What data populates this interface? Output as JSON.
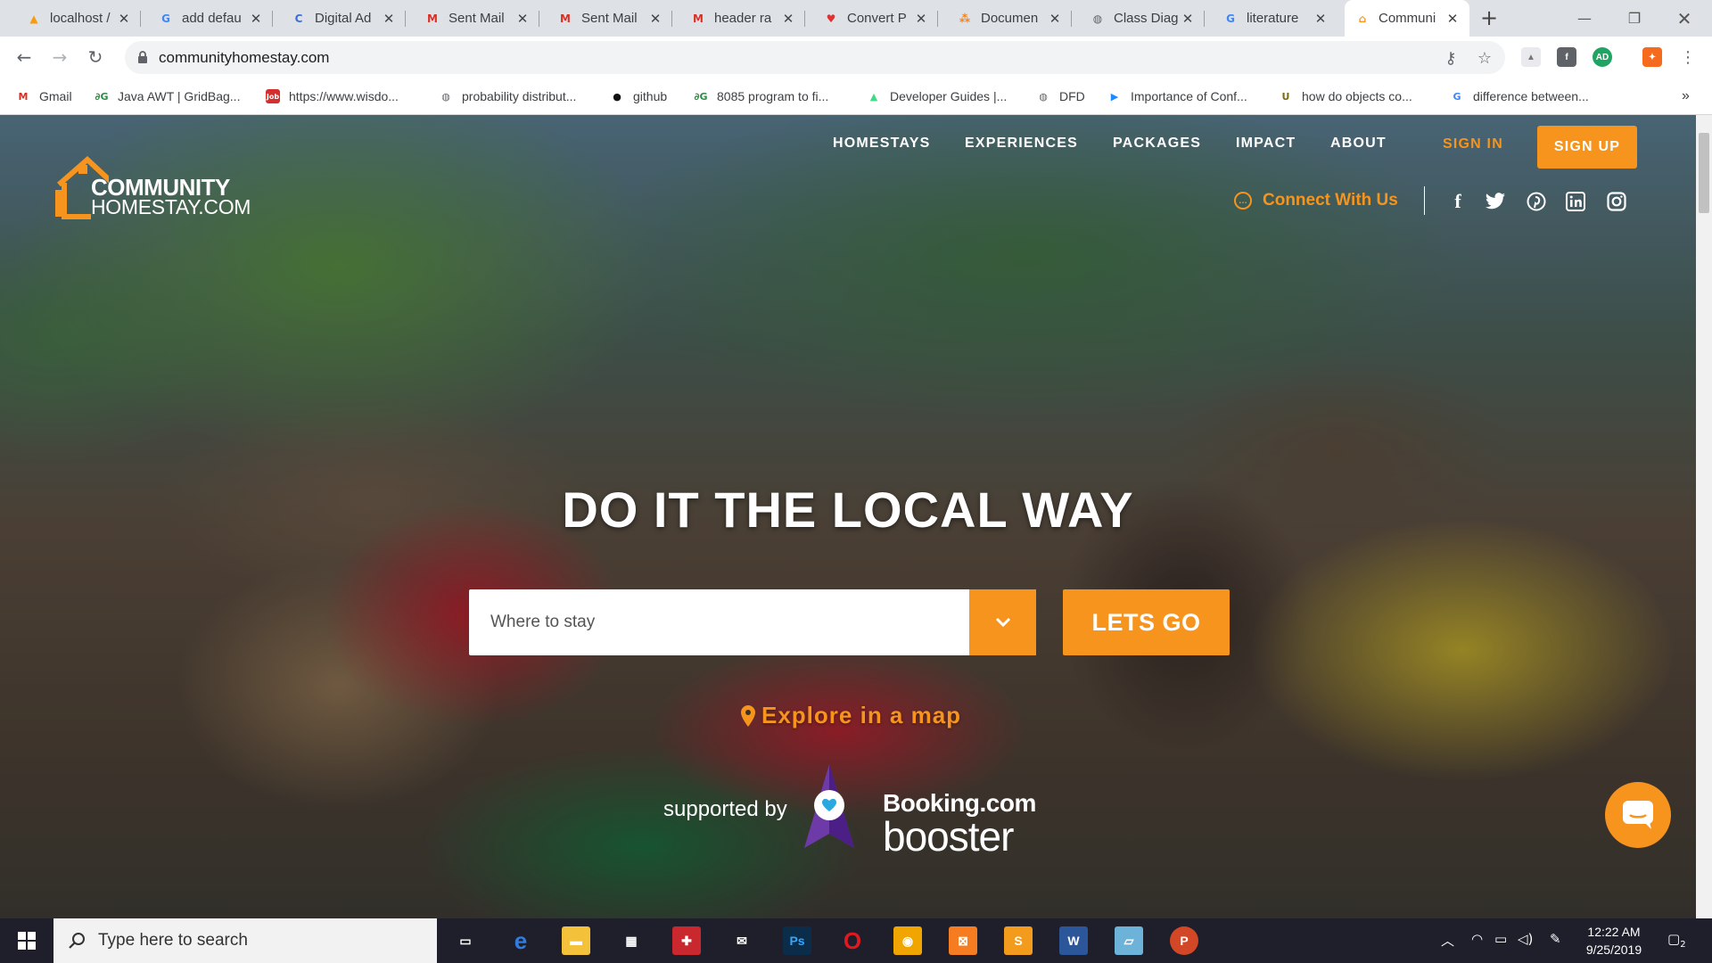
{
  "browser": {
    "tabs": [
      {
        "label": "localhost /",
        "favicon": "phpmyadmin-icon",
        "color": "#f89c0e",
        "glyph": "▲"
      },
      {
        "label": "add defau",
        "favicon": "google-icon",
        "color": "#4285f4",
        "glyph": "G"
      },
      {
        "label": "Digital Ad",
        "favicon": "c-logo-icon",
        "color": "#3b6fd8",
        "glyph": "C"
      },
      {
        "label": "Sent Mail",
        "favicon": "gmail-icon",
        "color": "#d93025",
        "glyph": "M"
      },
      {
        "label": "Sent Mail",
        "favicon": "gmail-icon",
        "color": "#d93025",
        "glyph": "M"
      },
      {
        "label": "header ra",
        "favicon": "gmail-icon",
        "color": "#d93025",
        "glyph": "M"
      },
      {
        "label": "Convert P",
        "favicon": "heart-icon",
        "color": "#e03030",
        "glyph": "♥"
      },
      {
        "label": "Documen",
        "favicon": "diagram-icon",
        "color": "#f57f17",
        "glyph": "⁂"
      },
      {
        "label": "Class Diag",
        "favicon": "globe-icon",
        "color": "#5f6368",
        "glyph": "◍"
      },
      {
        "label": "literature",
        "favicon": "google-icon",
        "color": "#4285f4",
        "glyph": "G"
      },
      {
        "label": "Communi",
        "favicon": "homestay-icon",
        "color": "#f7941d",
        "glyph": "⌂"
      }
    ],
    "active_tab": 10,
    "url": "communityhomestay.com",
    "bookmarks": [
      {
        "label": "Gmail",
        "icon": "gmail-icon",
        "color": "#d93025",
        "glyph": "M"
      },
      {
        "label": "Java AWT | GridBag...",
        "icon": "gfg-icon",
        "color": "#2f8d46",
        "glyph": "∂G"
      },
      {
        "label": "https://www.wisdo...",
        "icon": "job-icon",
        "color": "#d32f2f",
        "glyph": "Job"
      },
      {
        "label": "probability distribut...",
        "icon": "globe-icon",
        "color": "#5f6368",
        "glyph": "◍"
      },
      {
        "label": "github",
        "icon": "github-icon",
        "color": "#111111",
        "glyph": "●"
      },
      {
        "label": "8085 program to fi...",
        "icon": "gfg-icon",
        "color": "#2f8d46",
        "glyph": "∂G"
      },
      {
        "label": "Developer Guides |...",
        "icon": "android-icon",
        "color": "#3ddc84",
        "glyph": "▲"
      },
      {
        "label": "DFD",
        "icon": "globe-icon",
        "color": "#5f6368",
        "glyph": "◍"
      },
      {
        "label": "Importance of Conf...",
        "icon": "play-icon",
        "color": "#1a8cff",
        "glyph": "▶"
      },
      {
        "label": "how do objects co...",
        "icon": "u-logo-icon",
        "color": "#7a6a10",
        "glyph": "U"
      },
      {
        "label": "difference between...",
        "icon": "google-icon",
        "color": "#4285f4",
        "glyph": "G"
      }
    ]
  },
  "site": {
    "logo_line1": "COMMUNITY",
    "logo_line2": "HOMESTAY.COM",
    "nav": [
      "HOMESTAYS",
      "EXPERIENCES",
      "PACKAGES",
      "IMPACT",
      "ABOUT"
    ],
    "sign_in": "SIGN IN",
    "sign_up": "SIGN UP",
    "connect": "Connect With Us",
    "social": [
      "facebook-icon",
      "twitter-icon",
      "pinterest-icon",
      "linkedin-icon",
      "instagram-icon"
    ],
    "hero_title": "DO IT THE LOCAL WAY",
    "search_placeholder": "Where to stay",
    "search_button": "LETS GO",
    "explore": "Explore in a map",
    "supported_by": "supported by",
    "booking_name": "Booking.com",
    "booking_sub": "booster",
    "accent": "#f7941d"
  },
  "taskbar": {
    "search_placeholder": "Type here to search",
    "apps": [
      "task-view-icon",
      "edge-icon",
      "file-explorer-icon",
      "store-icon",
      "gift-icon",
      "mail-icon",
      "photoshop-icon",
      "opera-icon",
      "browser-icon",
      "xampp-icon",
      "sublime-icon",
      "word-icon",
      "notepad-icon",
      "powerpoint-icon"
    ],
    "time": "12:22 AM",
    "date": "9/25/2019",
    "notifications": "2"
  }
}
